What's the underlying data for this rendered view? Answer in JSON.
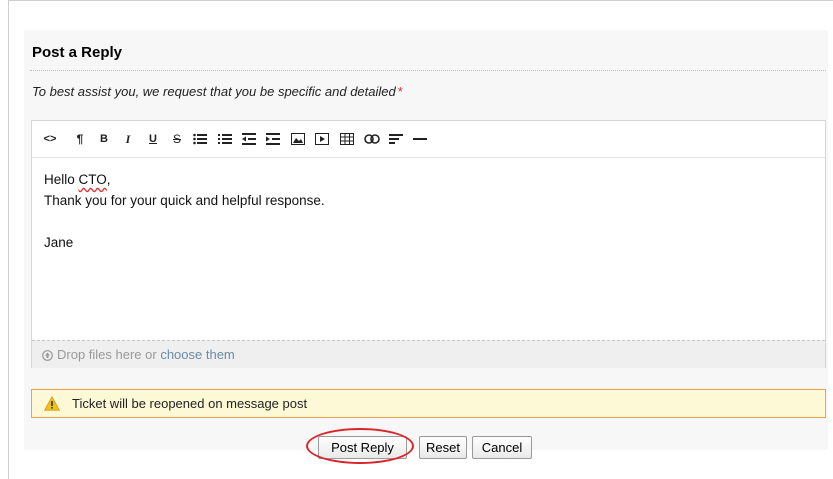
{
  "form": {
    "title": "Post a Reply",
    "instruction": "To best assist you, we request that you be specific and detailed",
    "required_mark": "*"
  },
  "toolbar": {
    "buttons": [
      {
        "name": "code-view-icon",
        "glyph": "<>"
      },
      {
        "name": "paragraph-icon",
        "glyph": "¶"
      },
      {
        "name": "bold-icon",
        "glyph": "B"
      },
      {
        "name": "italic-icon",
        "glyph": "I"
      },
      {
        "name": "underline-icon",
        "glyph": "U"
      },
      {
        "name": "strikethrough-icon",
        "glyph": "S"
      },
      {
        "name": "unordered-list-icon",
        "glyph": ""
      },
      {
        "name": "ordered-list-icon",
        "glyph": ""
      },
      {
        "name": "outdent-icon",
        "glyph": ""
      },
      {
        "name": "indent-icon",
        "glyph": ""
      },
      {
        "name": "image-icon",
        "glyph": ""
      },
      {
        "name": "video-icon",
        "glyph": ""
      },
      {
        "name": "table-icon",
        "glyph": ""
      },
      {
        "name": "link-icon",
        "glyph": ""
      },
      {
        "name": "align-icon",
        "glyph": ""
      },
      {
        "name": "horizontal-rule-icon",
        "glyph": ""
      }
    ]
  },
  "editor": {
    "greeting_prefix": "Hello ",
    "greeting_name": "CTO",
    "greeting_suffix": ",",
    "line2": "Thank you for your quick and helpful response.",
    "line3": "",
    "line4": "Jane"
  },
  "dropzone": {
    "text": "Drop files here or ",
    "link": "choose them"
  },
  "notice": {
    "text": "Ticket will be reopened on message post",
    "color": "#e9a24d"
  },
  "actions": {
    "post": "Post Reply",
    "reset": "Reset",
    "cancel": "Cancel",
    "highlight_color": "#d8262a"
  }
}
